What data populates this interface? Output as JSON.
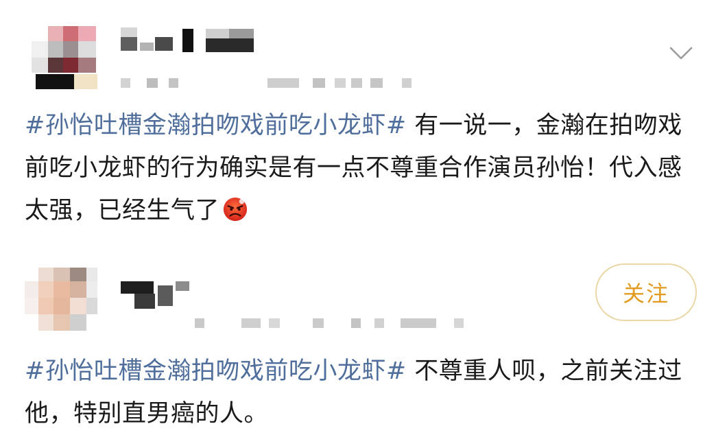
{
  "posts": [
    {
      "hashtag": "#孙怡吐槽金瀚拍吻戏前吃小龙虾#",
      "text": " 有一说一，金瀚在拍吻戏前吃小龙虾的行为确实是有一点不尊重合作演员孙怡！代入感太强，已经生气了",
      "emoji": "angry-face-emoji",
      "menu_icon": "chevron-down-icon"
    },
    {
      "hashtag": "#孙怡吐槽金瀚拍吻戏前吃小龙虾#",
      "text": " 不尊重人呗，之前关注过他，特别直男癌的人。",
      "follow_label": "关注"
    }
  ],
  "colors": {
    "hashtag": "#4f6e9b",
    "follow_text": "#e39b1f",
    "follow_border": "#ead7a6"
  }
}
